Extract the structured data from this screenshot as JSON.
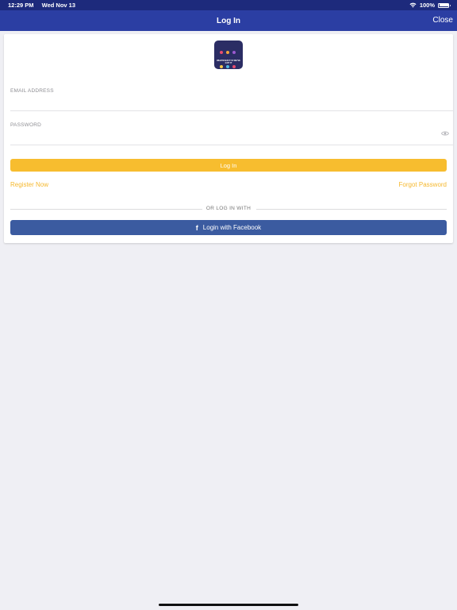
{
  "status_bar": {
    "time": "12:29 PM",
    "date": "Wed Nov 13",
    "battery": "100%",
    "wifi_icon": "wifi-icon",
    "battery_icon": "battery-icon"
  },
  "nav": {
    "title": "Log In",
    "close_label": "Close"
  },
  "logo": {
    "text": "WHATEVER IT IS WE'VE GOT IT",
    "icon": "app-logo"
  },
  "form": {
    "email_label": "EMAIL ADDRESS",
    "email_value": "",
    "password_label": "PASSWORD",
    "password_value": "",
    "password_toggle_icon": "eye-icon",
    "login_label": "Log In",
    "register_label": "Register Now",
    "forgot_label": "Forgot Password",
    "divider_text": "OR LOG IN WITH",
    "facebook_label": "Login with Facebook",
    "facebook_icon": "facebook-icon"
  },
  "colors": {
    "status_bar": "#1d2a7c",
    "nav_bar": "#2b3ea3",
    "accent": "#f7bd2f",
    "link": "#f5b82e",
    "facebook": "#3b5ba0",
    "background": "#efeff4"
  }
}
